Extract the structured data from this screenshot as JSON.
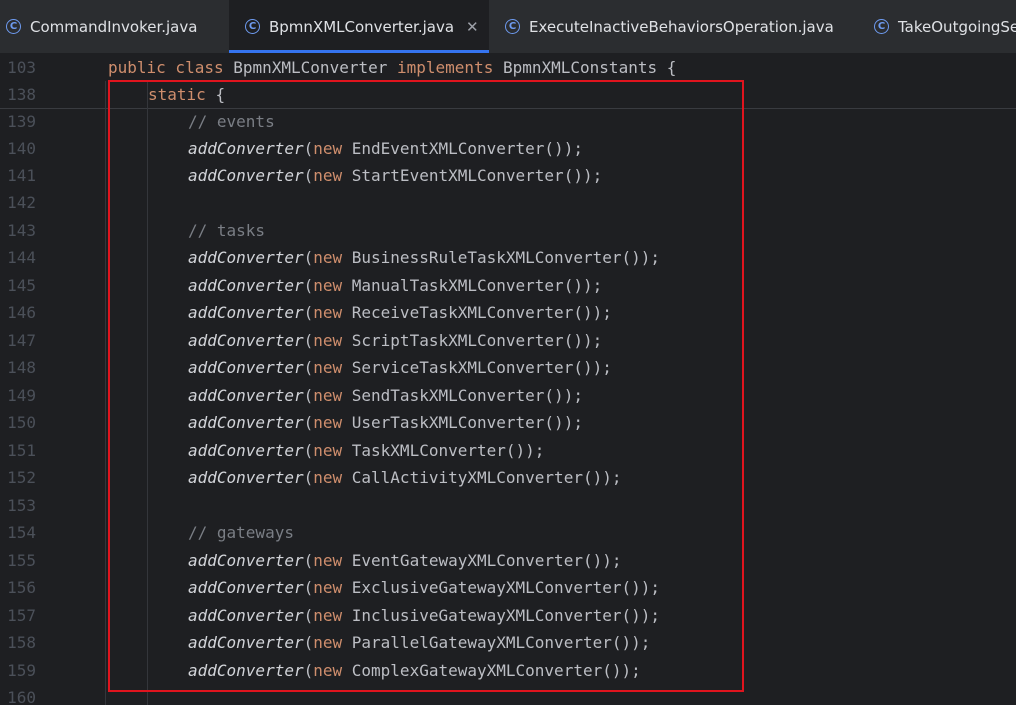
{
  "tabs": [
    {
      "label": "CommandInvoker.java",
      "icon": "java-class-icon"
    },
    {
      "label": "BpmnXMLConverter.java",
      "icon": "java-class-icon",
      "active": true
    },
    {
      "label": "ExecuteInactiveBehaviorsOperation.java",
      "icon": "java-class-icon"
    },
    {
      "label": "TakeOutgoingSe",
      "icon": "java-class-icon"
    }
  ],
  "code_lines": [
    {
      "num": "103",
      "tokens": [
        [
          "kw",
          "public class "
        ],
        [
          "tx",
          "BpmnXMLConverter "
        ],
        [
          "kw",
          "implements "
        ],
        [
          "tx",
          "BpmnXMLConstants {"
        ]
      ]
    },
    {
      "num": "138",
      "tokens": [
        [
          "kw",
          "static "
        ],
        [
          "tx",
          "{"
        ]
      ]
    },
    {
      "num": "139",
      "tokens": [
        [
          "cm",
          "// events"
        ]
      ]
    },
    {
      "num": "140",
      "tokens": [
        [
          "fn",
          "addConverter"
        ],
        [
          "tx",
          "("
        ],
        [
          "kw",
          "new "
        ],
        [
          "tx",
          "EndEventXMLConverter());"
        ]
      ]
    },
    {
      "num": "141",
      "tokens": [
        [
          "fn",
          "addConverter"
        ],
        [
          "tx",
          "("
        ],
        [
          "kw",
          "new "
        ],
        [
          "tx",
          "StartEventXMLConverter());"
        ]
      ]
    },
    {
      "num": "142",
      "tokens": []
    },
    {
      "num": "143",
      "tokens": [
        [
          "cm",
          "// tasks"
        ]
      ]
    },
    {
      "num": "144",
      "tokens": [
        [
          "fn",
          "addConverter"
        ],
        [
          "tx",
          "("
        ],
        [
          "kw",
          "new "
        ],
        [
          "tx",
          "BusinessRuleTaskXMLConverter());"
        ]
      ]
    },
    {
      "num": "145",
      "tokens": [
        [
          "fn",
          "addConverter"
        ],
        [
          "tx",
          "("
        ],
        [
          "kw",
          "new "
        ],
        [
          "tx",
          "ManualTaskXMLConverter());"
        ]
      ]
    },
    {
      "num": "146",
      "tokens": [
        [
          "fn",
          "addConverter"
        ],
        [
          "tx",
          "("
        ],
        [
          "kw",
          "new "
        ],
        [
          "tx",
          "ReceiveTaskXMLConverter());"
        ]
      ]
    },
    {
      "num": "147",
      "tokens": [
        [
          "fn",
          "addConverter"
        ],
        [
          "tx",
          "("
        ],
        [
          "kw",
          "new "
        ],
        [
          "tx",
          "ScriptTaskXMLConverter());"
        ]
      ]
    },
    {
      "num": "148",
      "tokens": [
        [
          "fn",
          "addConverter"
        ],
        [
          "tx",
          "("
        ],
        [
          "kw",
          "new "
        ],
        [
          "tx",
          "ServiceTaskXMLConverter());"
        ]
      ]
    },
    {
      "num": "149",
      "tokens": [
        [
          "fn",
          "addConverter"
        ],
        [
          "tx",
          "("
        ],
        [
          "kw",
          "new "
        ],
        [
          "tx",
          "SendTaskXMLConverter());"
        ]
      ]
    },
    {
      "num": "150",
      "tokens": [
        [
          "fn",
          "addConverter"
        ],
        [
          "tx",
          "("
        ],
        [
          "kw",
          "new "
        ],
        [
          "tx",
          "UserTaskXMLConverter());"
        ]
      ]
    },
    {
      "num": "151",
      "tokens": [
        [
          "fn",
          "addConverter"
        ],
        [
          "tx",
          "("
        ],
        [
          "kw",
          "new "
        ],
        [
          "tx",
          "TaskXMLConverter());"
        ]
      ]
    },
    {
      "num": "152",
      "tokens": [
        [
          "fn",
          "addConverter"
        ],
        [
          "tx",
          "("
        ],
        [
          "kw",
          "new "
        ],
        [
          "tx",
          "CallActivityXMLConverter());"
        ]
      ]
    },
    {
      "num": "153",
      "tokens": []
    },
    {
      "num": "154",
      "tokens": [
        [
          "cm",
          "// gateways"
        ]
      ]
    },
    {
      "num": "155",
      "tokens": [
        [
          "fn",
          "addConverter"
        ],
        [
          "tx",
          "("
        ],
        [
          "kw",
          "new "
        ],
        [
          "tx",
          "EventGatewayXMLConverter());"
        ]
      ]
    },
    {
      "num": "156",
      "tokens": [
        [
          "fn",
          "addConverter"
        ],
        [
          "tx",
          "("
        ],
        [
          "kw",
          "new "
        ],
        [
          "tx",
          "ExclusiveGatewayXMLConverter());"
        ]
      ]
    },
    {
      "num": "157",
      "tokens": [
        [
          "fn",
          "addConverter"
        ],
        [
          "tx",
          "("
        ],
        [
          "kw",
          "new "
        ],
        [
          "tx",
          "InclusiveGatewayXMLConverter());"
        ]
      ]
    },
    {
      "num": "158",
      "tokens": [
        [
          "fn",
          "addConverter"
        ],
        [
          "tx",
          "("
        ],
        [
          "kw",
          "new "
        ],
        [
          "tx",
          "ParallelGatewayXMLConverter());"
        ]
      ]
    },
    {
      "num": "159",
      "tokens": [
        [
          "fn",
          "addConverter"
        ],
        [
          "tx",
          "("
        ],
        [
          "kw",
          "new "
        ],
        [
          "tx",
          "ComplexGatewayXMLConverter());"
        ]
      ]
    },
    {
      "num": "160",
      "tokens": []
    }
  ],
  "colors": {
    "keyword": "#cf8e6d",
    "method_call": "#d2d4d9",
    "comment": "#7a7e85",
    "text": "#bcbec4",
    "line_number": "#4b5059",
    "highlight_box": "#e0141e",
    "active_tab_underline": "#3574f0"
  }
}
